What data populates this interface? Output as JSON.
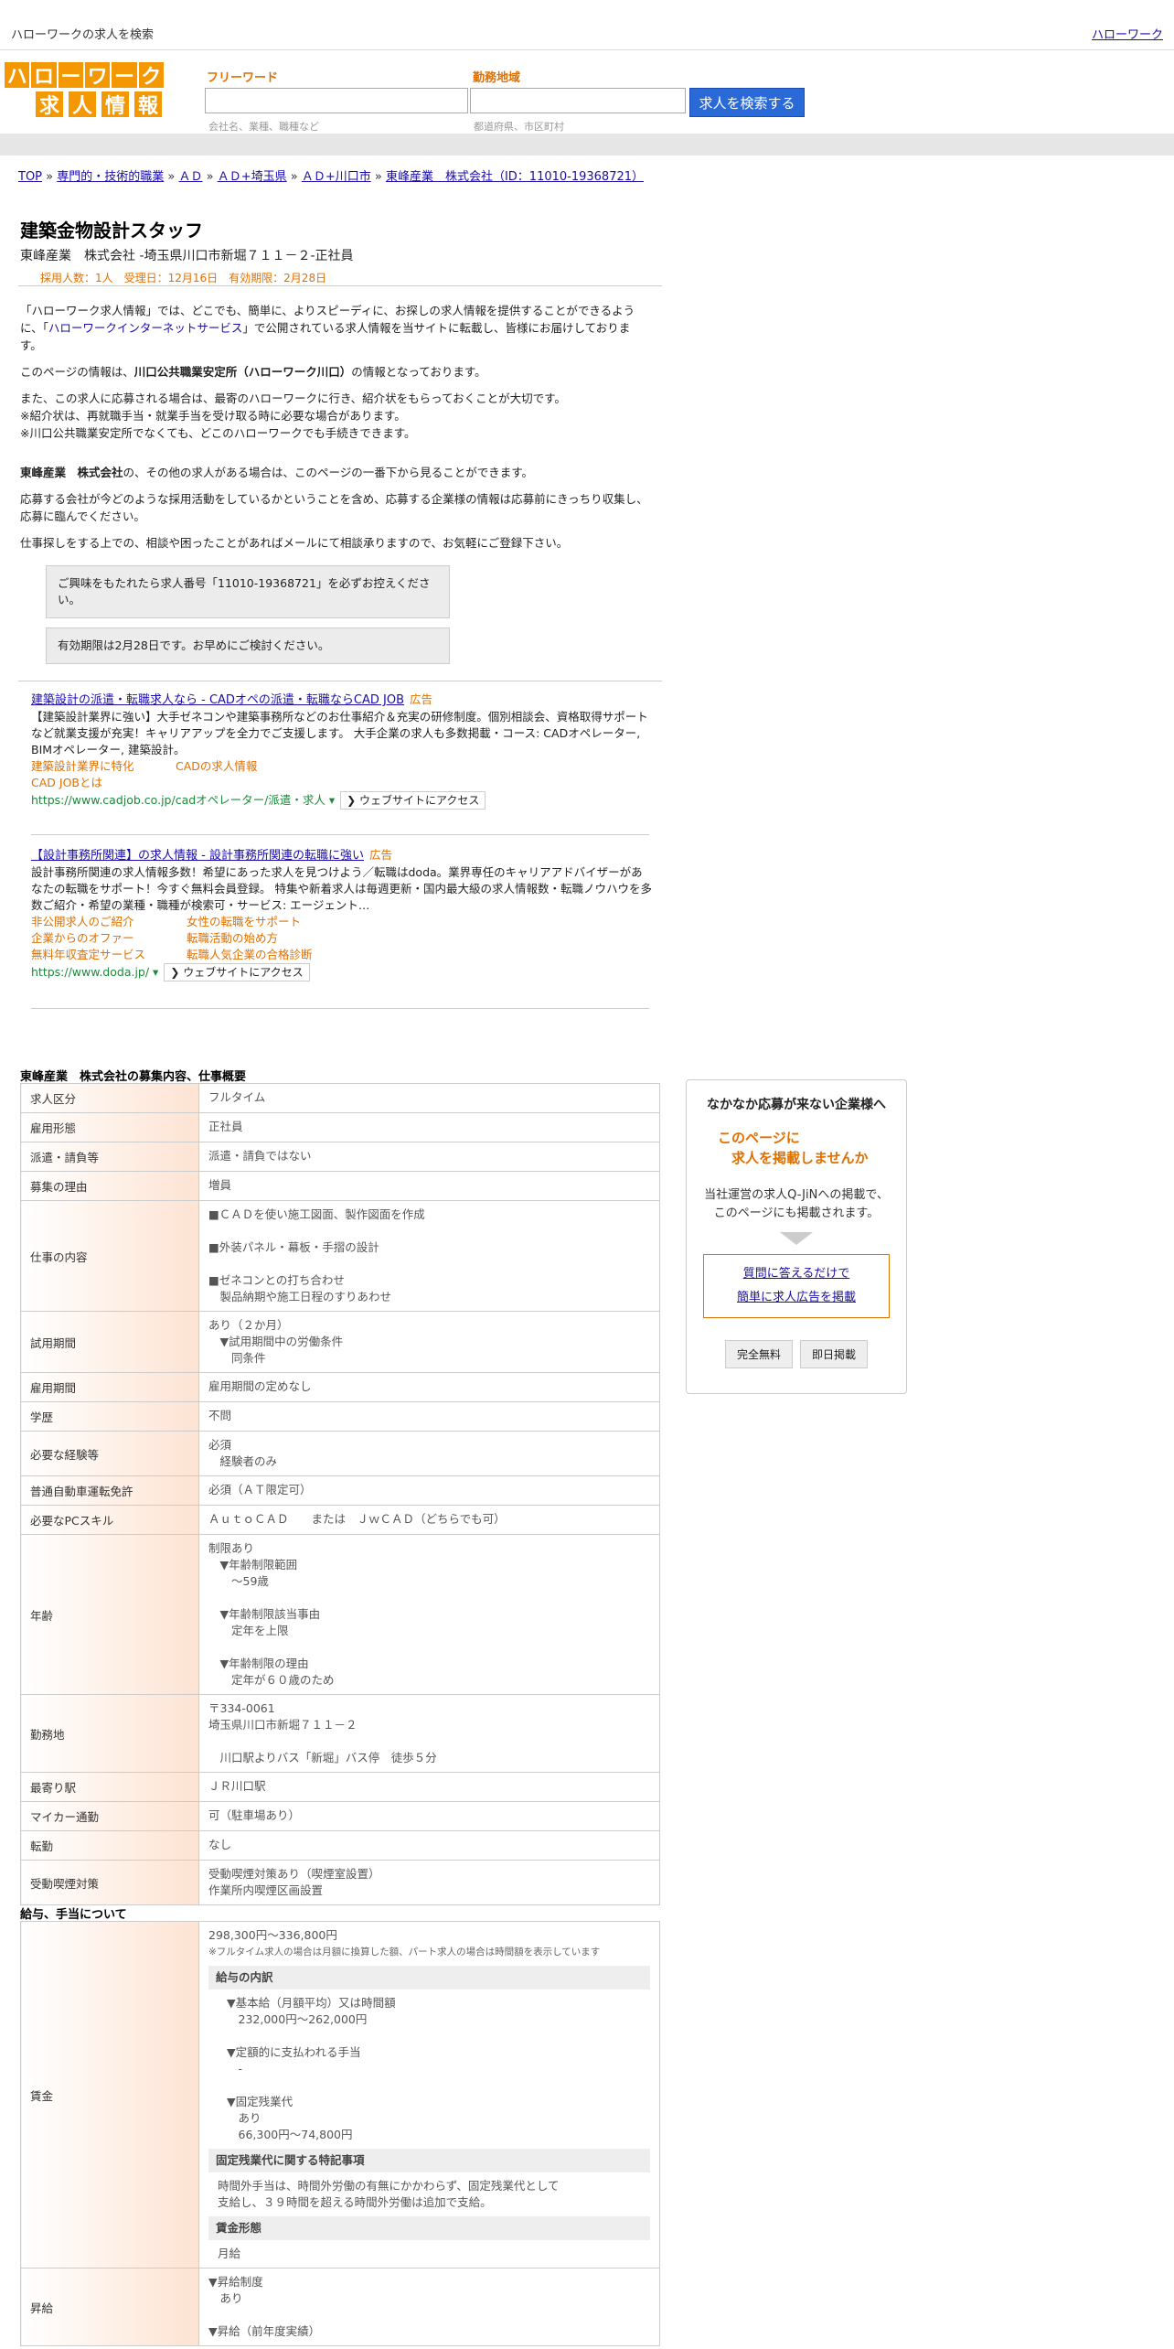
{
  "topbar": {
    "title": "ハローワークの求人を検索",
    "right_link": "ハローワーク"
  },
  "logo": {
    "row1": [
      "ハ",
      "ロ",
      "ー",
      "ワ",
      "ー",
      "ク"
    ],
    "row2": [
      "求",
      "人",
      "情",
      "報"
    ]
  },
  "search": {
    "free_label": "フリーワード",
    "free_placeholder": "会社名、業種、職種など",
    "area_label": "勤務地域",
    "area_placeholder": "都道府県、市区町村",
    "button": "求人を検索する"
  },
  "breadcrumb": [
    "TOP",
    "専門的・技術的職業",
    "ＡＤ",
    "ＡＤ+埼玉県",
    "ＡＤ+川口市",
    "東峰産業　株式会社（ID：11010-19368721）"
  ],
  "job": {
    "title": "建築金物設計スタッフ",
    "subtitle": "東峰産業　株式会社 -埼玉県川口市新堀７１１－２-正社員",
    "meta": "採用人数：1人　受理日：12月16日　有効期限：2月28日"
  },
  "intro": {
    "p1a": "「ハローワーク求人情報」では、どこでも、簡単に、よりスピーディに、お探しの求人情報を提供することができるように、「",
    "p1link": "ハローワークインターネットサービス",
    "p1b": "」で公開されている求人情報を当サイトに転載し、皆様にお届けしております。",
    "p2a": "このページの情報は、",
    "p2b": "川口公共職業安定所（ハローワーク川口）",
    "p2c": "の情報となっております。",
    "p3": "また、この求人に応募される場合は、最寄のハローワークに行き、紹介状をもらっておくことが大切です。",
    "p3b": "※紹介状は、再就職手当・就業手当を受け取る時に必要な場合があります。",
    "p3c": "※川口公共職業安定所でなくても、どこのハローワークでも手続きできます。",
    "p4a": "東峰産業　株式会社",
    "p4b": "の、その他の求人がある場合は、このページの一番下から見ることができます。",
    "p5": "応募する会社が今どのような採用活動をしているかということを含め、応募する企業様の情報は応募前にきっちり収集し、応募に臨んでください。",
    "p6": "仕事探しをする上での、相談や困ったことがあればメールにて相談承りますので、お気軽にご登録下さい。"
  },
  "notes": {
    "n1": "ご興味をもたれたら求人番号「11010-19368721」を必ずお控えください。",
    "n2": "有効期限は2月28日です。お早めにご検討ください。"
  },
  "ads": [
    {
      "title": "建築設計の派遣・転職求人なら - CADオペの派遣・転職ならCAD JOB",
      "tag": "広告",
      "desc": "【建築設計業界に強い】大手ゼネコンや建築事務所などのお仕事紹介＆充実の研修制度。個別相談会、資格取得サポートなど就業支援が充実！キャリアアップを全力でご支援します。 大手企業の求人も多数掲載・コース: CADオペレーター, BIMオペレーター, 建築設計。",
      "links": [
        [
          "建築設計業界に特化",
          "CADの求人情報"
        ],
        [
          "CAD JOBとは",
          ""
        ]
      ],
      "url": "https://www.cadjob.co.jp/cadオペレーター/派遣・求人",
      "visit": "❯ ウェブサイトにアクセス"
    },
    {
      "title": "【設計事務所関連】の求人情報 - 設計事務所関連の転職に強い",
      "tag": "広告",
      "desc": "設計事務所関連の求人情報多数！希望にあった求人を見つけよう／転職はdoda。業界専任のキャリアアドバイザーがあなたの転職をサポート！今すぐ無料会員登録。 特集や新着求人は毎週更新・国内最大級の求人情報数・転職ノウハウを多数ご紹介・希望の業種・職種が検索可・サービス: エージェント…",
      "links": [
        [
          "非公開求人のご紹介",
          "女性の転職をサポート"
        ],
        [
          "企業からのオファー",
          "転職活動の始め方"
        ],
        [
          "無料年収査定サービス",
          "転職人気企業の合格診断"
        ]
      ],
      "url": "https://www.doda.jp/",
      "visit": "❯ ウェブサイトにアクセス"
    }
  ],
  "recruit": {
    "title": "東峰産業　株式会社の募集内容、仕事概要",
    "rows": [
      {
        "k": "求人区分",
        "v": [
          "フルタイム"
        ]
      },
      {
        "k": "雇用形態",
        "v": [
          "正社員"
        ]
      },
      {
        "k": "派遣・請負等",
        "v": [
          "派遣・請負ではない"
        ]
      },
      {
        "k": "募集の理由",
        "v": [
          "増員"
        ]
      },
      {
        "k": "仕事の内容",
        "v": [
          "■ＣＡＤを使い施工図面、製作図面を作成",
          "",
          "■外装パネル・幕板・手摺の設計",
          "",
          "■ゼネコンとの打ち合わせ",
          "　製品納期や施工日程のすりあわせ"
        ]
      },
      {
        "k": "試用期間",
        "v": [
          "あり（２か月）",
          "　▼試用期間中の労働条件",
          "　　同条件"
        ]
      },
      {
        "k": "雇用期間",
        "v": [
          "雇用期間の定めなし"
        ]
      },
      {
        "k": "学歴",
        "v": [
          "不問"
        ]
      },
      {
        "k": "必要な経験等",
        "v": [
          "必須",
          "　経験者のみ"
        ]
      },
      {
        "k": "普通自動車運転免許",
        "v": [
          "必須（ＡＴ限定可）"
        ]
      },
      {
        "k": "必要なPCスキル",
        "v": [
          "ＡｕｔｏＣＡＤ　　または　ＪｗＣＡＤ（どちらでも可）"
        ]
      },
      {
        "k": "年齢",
        "v": [
          "制限あり",
          "　▼年齢制限範囲",
          "　　〜59歳",
          "",
          "　▼年齢制限該当事由",
          "　　定年を上限",
          "",
          "　▼年齢制限の理由",
          "　　定年が６０歳のため"
        ]
      },
      {
        "k": "勤務地",
        "v": [
          "〒334-0061",
          "埼玉県川口市新堀７１１－２",
          "",
          "　川口駅よりバス「新堀」バス停　徒歩５分"
        ]
      },
      {
        "k": "最寄り駅",
        "v": [
          "ＪＲ川口駅"
        ]
      },
      {
        "k": "マイカー通勤",
        "v": [
          "可（駐車場あり）"
        ]
      },
      {
        "k": "転勤",
        "v": [
          "なし"
        ]
      },
      {
        "k": "受動喫煙対策",
        "v": [
          "受動喫煙対策あり（喫煙室設置）",
          "作業所内喫煙区画設置"
        ]
      }
    ]
  },
  "salary": {
    "title": "給与、手当について",
    "wage_key": "賃金",
    "wage_range": "298,300円〜336,800円",
    "wage_note": "※フルタイム求人の場合は月額に換算した額、パート求人の場合は時間額を表示しています",
    "breakdown_head": "給与の内訳",
    "breakdown": [
      "▼基本給（月額平均）又は時間額",
      "　232,000円〜262,000円",
      "",
      "▼定額的に支払われる手当",
      "　-",
      "",
      "▼固定残業代",
      "　あり",
      "　66,300円〜74,800円"
    ],
    "fixed_head": "固定残業代に関する特記事項",
    "fixed": [
      "時間外手当は、時間外労働の有無にかかわらず、固定残業代として",
      "支給し、３９時間を超える時間外労働は追加で支給。"
    ],
    "form_head": "賃金形態",
    "form": "月給",
    "raise_key": "昇給",
    "raise": [
      "▼昇給制度",
      "　あり",
      "",
      "▼昇給（前年度実績）"
    ]
  },
  "side": {
    "title": "なかなか応募が来ない企業様へ",
    "offer": [
      "このページに",
      "　求人を掲載しませんか"
    ],
    "desc": [
      "当社運営の求人Q-JiNへの掲載で、",
      "このページにも掲載されます。"
    ],
    "link1": "質問に答えるだけで",
    "link2": "簡単に求人広告を掲載",
    "btn1": "完全無料",
    "btn2": "即日掲載"
  }
}
